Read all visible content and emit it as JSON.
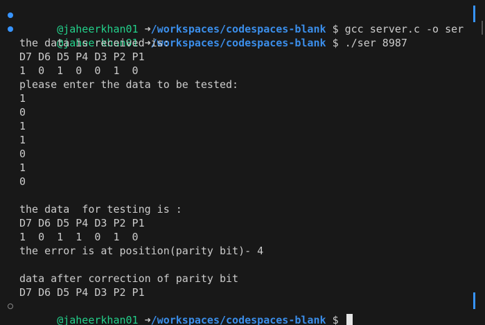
{
  "prompt": {
    "user": "@jaheerkhan01",
    "arrow": "➜",
    "path": "/workspaces/codespaces-blank",
    "symbol": "$"
  },
  "commands": [
    "gcc server.c -o ser",
    "./ser 8987"
  ],
  "output": [
    "the data is received is:",
    "D7 D6 D5 P4 D3 P2 P1",
    "1  0  1  0  0  1  0",
    "please enter the data to be tested:",
    "1",
    "0",
    "1",
    "1",
    "0",
    "1",
    "0",
    "",
    "the data  for testing is :",
    "D7 D6 D5 P4 D3 P2 P1",
    "1  0  1  1  0  1  0",
    "the error is at position(parity bit)- 4",
    "",
    "data after correction of parity bit",
    "D7 D6 D5 P4 D3 P2 P1"
  ],
  "colors": {
    "background": "#181818",
    "user": "#23d18b",
    "path": "#3b8eea",
    "decoration_success": "#3794ff",
    "decoration_pending": "#888888",
    "text": "#cccccc"
  }
}
